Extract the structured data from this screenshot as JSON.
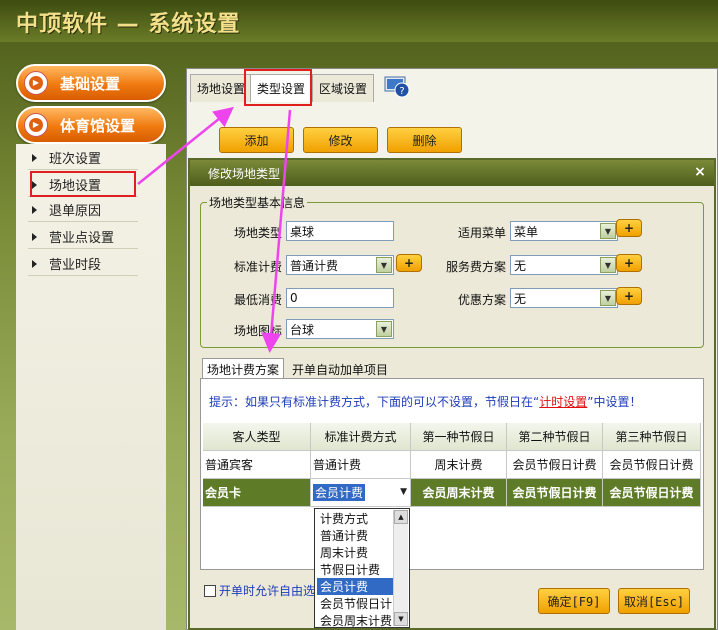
{
  "app": {
    "title": "中顶软件 — 系统设置"
  },
  "nav": {
    "basic_settings": "基础设置",
    "venue_settings": "体育馆设置",
    "sub_items": [
      {
        "label": "班次设置"
      },
      {
        "label": "场地设置"
      },
      {
        "label": "退单原因"
      },
      {
        "label": "营业点设置"
      },
      {
        "label": "营业时段"
      }
    ]
  },
  "tabs": [
    "场地设置",
    "类型设置",
    "区域设置"
  ],
  "toolbar": {
    "add": "添加",
    "edit": "修改",
    "delete": "删除"
  },
  "dialog": {
    "title": "修改场地类型",
    "close": "×",
    "groupbox_label": "场地类型基本信息",
    "fields": {
      "venue_type": {
        "label": "场地类型",
        "value": "桌球"
      },
      "applicable_menu": {
        "label": "适用菜单",
        "value": "菜单"
      },
      "standard_billing": {
        "label": "标准计费",
        "value": "普通计费"
      },
      "service_fee_plan": {
        "label": "服务费方案",
        "value": "无"
      },
      "min_consumption": {
        "label": "最低消费",
        "value": "0"
      },
      "discount_plan": {
        "label": "优惠方案",
        "value": "无"
      },
      "venue_icon": {
        "label": "场地图标",
        "value": "台球"
      }
    },
    "plus": "+",
    "lower_tabs": [
      "场地计费方案",
      "开单自动加单项目"
    ],
    "hint": {
      "prefix": "提示：如果只有标准计费方式，下面的可以不设置，节假日在“",
      "link": "计时设置",
      "suffix": "”中设置！"
    },
    "grid": {
      "headers": [
        "客人类型",
        "标准计费方式",
        "第一种节假日",
        "第二种节假日",
        "第三种节假日"
      ],
      "rows": [
        [
          "普通宾客",
          "普通计费",
          "周末计费",
          "会员节假日计费",
          "会员节假日计费"
        ],
        [
          "会员卡",
          "会员计费",
          "会员周末计费",
          "会员节假日计费",
          "会员节假日计费"
        ]
      ]
    },
    "dropdown_options": [
      "计费方式",
      "普通计费",
      "周末计费",
      "节假日计费",
      "会员计费",
      "会员节假日计",
      "会员周末计费"
    ],
    "dropdown_selected": "会员计费",
    "checkbox_label": "开单时允许自由选",
    "ok": "确定[F9]",
    "cancel": "取消[Esc]"
  },
  "colors": {
    "accent_orange": "#f07a10",
    "highlight_red": "#e02020",
    "arrow_magenta": "#ee44ee"
  }
}
